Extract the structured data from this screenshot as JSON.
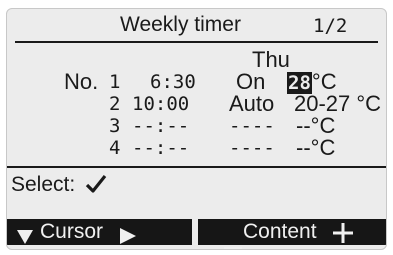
{
  "header": {
    "title": "Weekly timer",
    "page": "1/2"
  },
  "day": "Thu",
  "rows": [
    {
      "label": "No.",
      "num": "1",
      "time": "6:30",
      "mode": "On",
      "temp_highlight": "28",
      "temp_rest": "°C"
    },
    {
      "label": "",
      "num": "2",
      "time": "10:00",
      "mode": "Auto",
      "temp_highlight": "",
      "temp_rest": "20-27 °C"
    },
    {
      "label": "",
      "num": "3",
      "time": "--:--",
      "mode": "----",
      "temp_highlight": "",
      "temp_rest": "--°C"
    },
    {
      "label": "",
      "num": "4",
      "time": "--:--",
      "mode": "----",
      "temp_highlight": "",
      "temp_rest": "--°C"
    }
  ],
  "select": {
    "label": "Select:",
    "icon": "check-icon"
  },
  "buttons": {
    "cursor_label": "Cursor",
    "content_label": "Content"
  },
  "colors": {
    "screen": "#ececec",
    "ink": "#1a1a1a",
    "button_bg": "#161616"
  }
}
